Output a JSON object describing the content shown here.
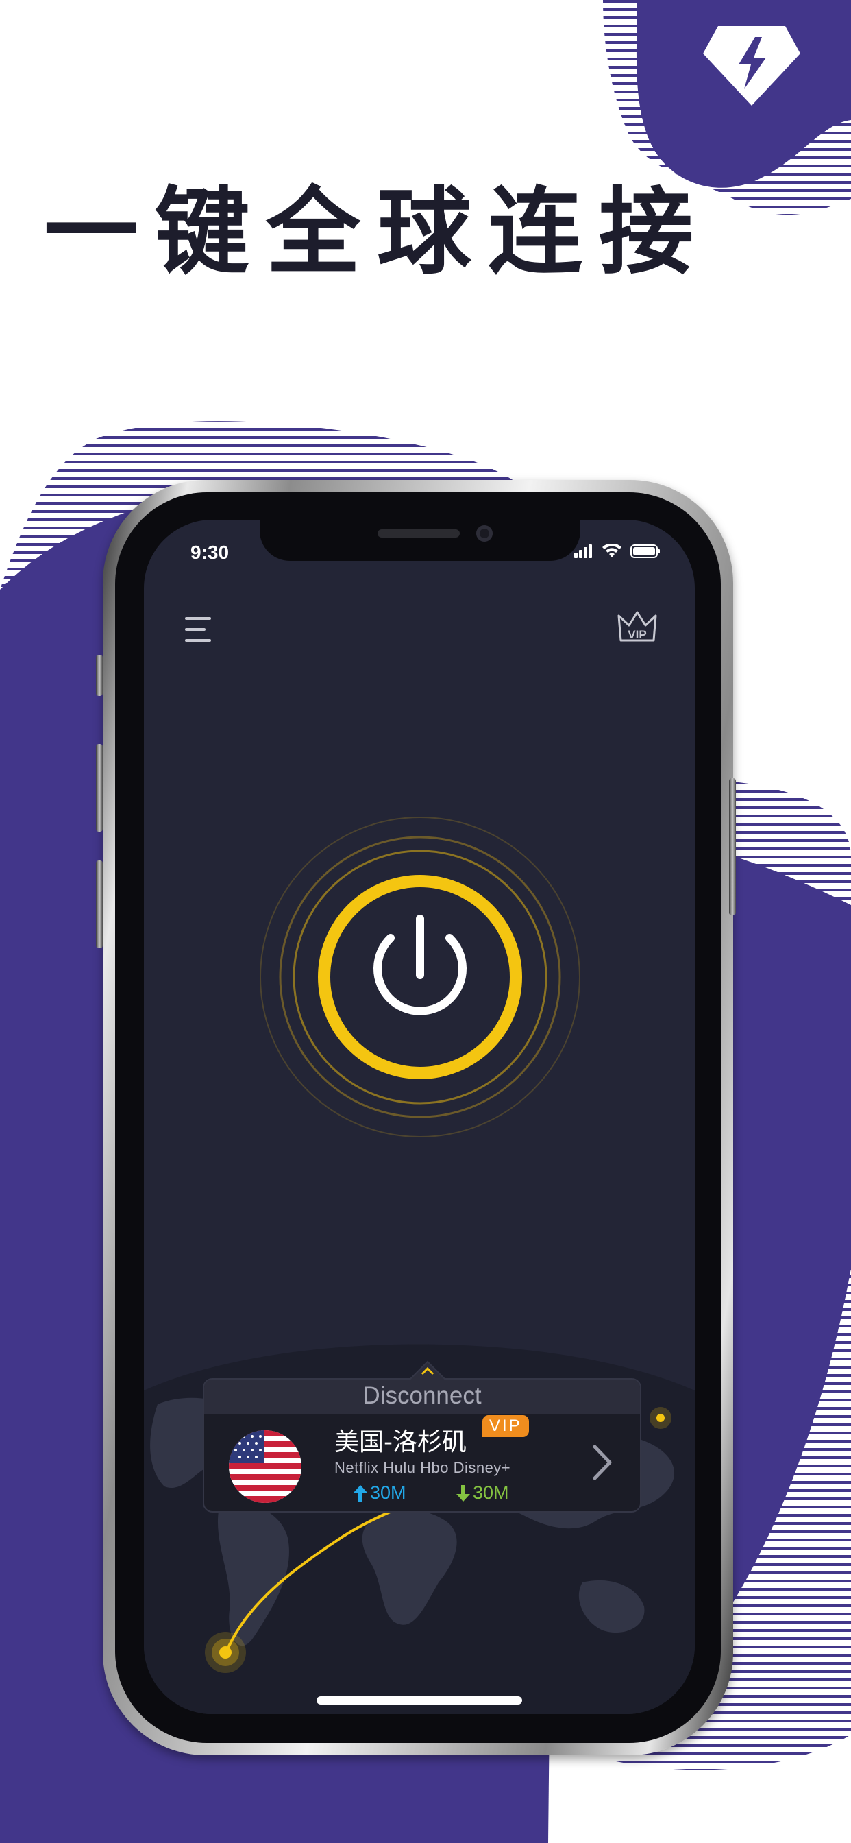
{
  "headline": "一键全球连接",
  "status_bar": {
    "time": "9:30"
  },
  "header": {
    "menu_icon": "hamburger-menu-icon",
    "vip_icon": "vip-crown-icon",
    "vip_text": "VIP"
  },
  "power": {
    "icon": "power-icon"
  },
  "server_card": {
    "tab_label": "Disconnect",
    "server_name": "美国-洛杉矶",
    "vip_badge": "VIP",
    "services": "Netflix Hulu Hbo Disney+",
    "upload_speed": "30M",
    "download_speed": "30M",
    "flag": "us-flag-icon"
  },
  "colors": {
    "brand_purple": "#42368a",
    "screen_bg": "#232536",
    "power_ring": "#f4c511",
    "upload": "#22a8e8",
    "download": "#84c341",
    "vip_orange": "#f08d1e"
  }
}
